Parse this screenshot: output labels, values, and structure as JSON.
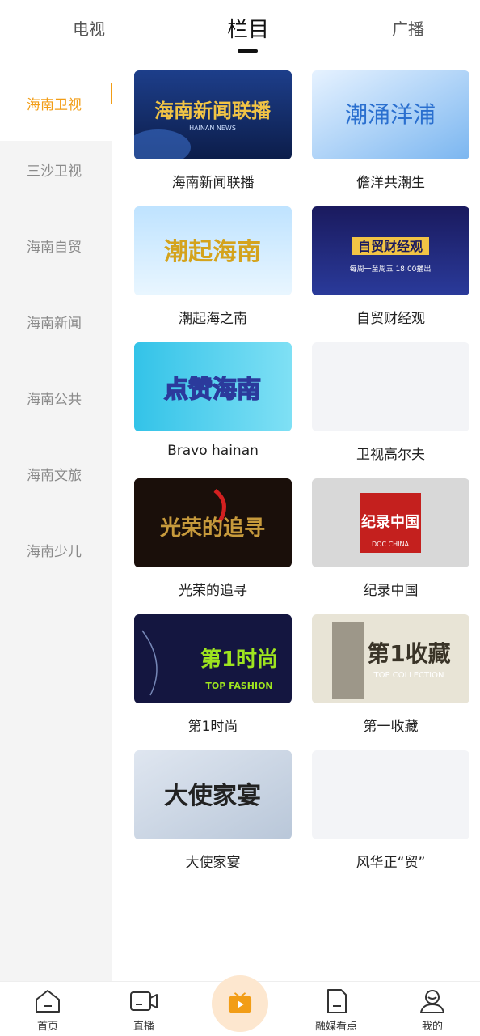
{
  "top_tabs": [
    {
      "label": "电视"
    },
    {
      "label": "栏目"
    },
    {
      "label": "广播"
    }
  ],
  "active_top_tab": "栏目",
  "sidebar": {
    "items": [
      {
        "label": "海南卫视"
      },
      {
        "label": "三沙卫视"
      },
      {
        "label": "海南自贸"
      },
      {
        "label": "海南新闻"
      },
      {
        "label": "海南公共"
      },
      {
        "label": "海南文旅"
      },
      {
        "label": "海南少儿"
      }
    ],
    "active": "海南卫视"
  },
  "programs": [
    {
      "title": "海南新闻联播",
      "thumb_text": "海南新闻联播",
      "thumb_sub": "HAINAN NEWS"
    },
    {
      "title": "儋洋共潮生",
      "thumb_text": "潮涌洋浦"
    },
    {
      "title": "潮起海之南",
      "thumb_text": "潮起海南"
    },
    {
      "title": "自贸财经观",
      "thumb_text": "自贸财经观",
      "thumb_sub": "每周一至周五 18:00播出"
    },
    {
      "title": "Bravo hainan",
      "thumb_text": "点赞海南"
    },
    {
      "title": "卫视高尔夫",
      "thumb_text": ""
    },
    {
      "title": "光荣的追寻",
      "thumb_text": "光荣的追寻"
    },
    {
      "title": "纪录中国",
      "thumb_text": "纪录中国",
      "thumb_sub": "DOC CHINA"
    },
    {
      "title": "第1时尚",
      "thumb_text": "第1时尚",
      "thumb_sub": "TOP FASHION"
    },
    {
      "title": "第一收藏",
      "thumb_text": "第1收藏",
      "thumb_sub": "TOP COLLECTION"
    },
    {
      "title": "大使家宴",
      "thumb_text": "大使家宴"
    },
    {
      "title": "风华正“贸”",
      "thumb_text": ""
    }
  ],
  "bottom_nav": [
    {
      "label": "首页",
      "icon": "home-icon"
    },
    {
      "label": "直播",
      "icon": "video-camera-icon"
    },
    {
      "label": "",
      "icon": "tv-play-icon"
    },
    {
      "label": "融媒看点",
      "icon": "document-icon"
    },
    {
      "label": "我的",
      "icon": "user-icon"
    }
  ],
  "colors": {
    "accent": "#f29d16",
    "sidebar_bg": "#f4f4f4"
  }
}
